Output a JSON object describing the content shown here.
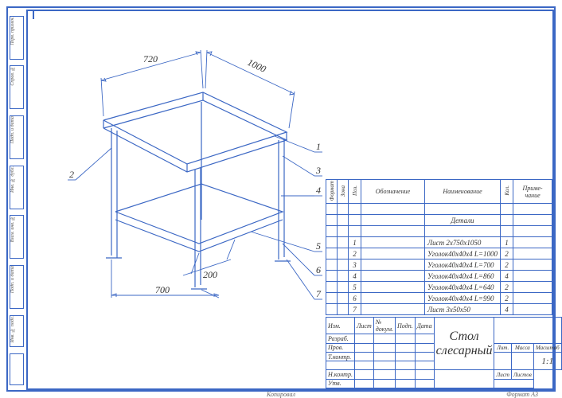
{
  "dims": {
    "d720": "720",
    "d1000": "1000",
    "d200": "200",
    "d700": "700"
  },
  "leaders": [
    "1",
    "2",
    "3",
    "4",
    "5",
    "6",
    "7"
  ],
  "stubs": [
    "Перв. примен.",
    "Справ. №",
    "Подп. и дата",
    "Инв. № дубл.",
    "Взам. инв. №",
    "Подп. и дата",
    "Инв. № подл.",
    ""
  ],
  "partsHeader": {
    "c1": "Формат",
    "c2": "Зона",
    "c3": "Поз.",
    "c4": "Обозначение",
    "c5": "Наименование",
    "c6": "Кол.",
    "c7": "Приме-\nчание"
  },
  "sectionTitle": "Детали",
  "parts": [
    {
      "pos": "1",
      "name": "Лист 2х750х1050",
      "qty": "1"
    },
    {
      "pos": "2",
      "name": "Уголок40х40х4 L=1000",
      "qty": "2"
    },
    {
      "pos": "3",
      "name": "Уголок40х40х4 L=700",
      "qty": "2"
    },
    {
      "pos": "4",
      "name": "Уголок40х40х4 L=860",
      "qty": "4"
    },
    {
      "pos": "5",
      "name": "Уголок40х40х4 L=640",
      "qty": "2"
    },
    {
      "pos": "6",
      "name": "Уголок40х40х4 L=990",
      "qty": "2"
    },
    {
      "pos": "7",
      "name": "Лист 3х50х50",
      "qty": "4"
    }
  ],
  "title": {
    "col1": [
      "Изм.",
      "Разраб.",
      "Пров.",
      "Т.контр.",
      "",
      "Н.контр.",
      "Утв."
    ],
    "hdr": [
      "Лист",
      "№ докум.",
      "Подп.",
      "Дата"
    ],
    "name": "Стол слесарный",
    "small": [
      "Лит.",
      "Масса",
      "Масштаб"
    ],
    "scale": "1:1",
    "sheet": "Лист",
    "sheets": "Листов",
    "format": "Формат   А3",
    "copy": "Копировал"
  }
}
